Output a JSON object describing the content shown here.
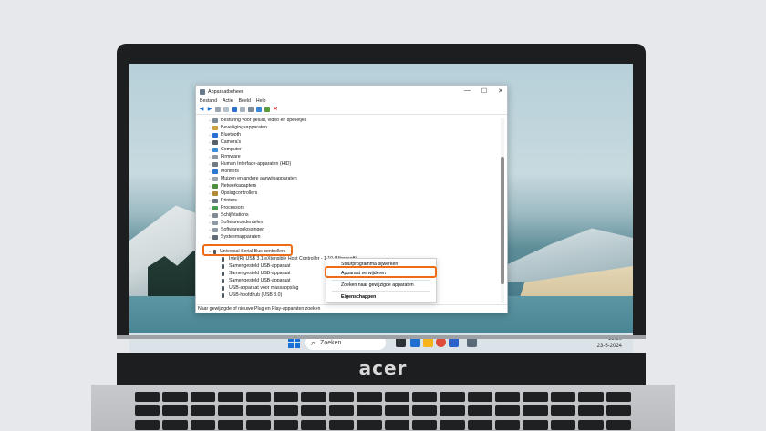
{
  "window": {
    "title": "Apparaatbeheer",
    "controls": {
      "minimize": "—",
      "maximize": "☐",
      "close": "✕"
    }
  },
  "menu": [
    "Bestand",
    "Actie",
    "Beeld",
    "Help"
  ],
  "tree": {
    "categories": [
      "Besturing voor geluid, video en spelletjes",
      "Beveiligingsapparaten",
      "Bluetooth",
      "Camera's",
      "Computer",
      "Firmware",
      "Human Interface-apparaten (HID)",
      "Monitors",
      "Muizen en andere aanwijsapparaten",
      "Netwerkadapters",
      "Opslagcontrollers",
      "Printers",
      "Processors",
      "Schijfstations",
      "Softwareonderdelen",
      "Softwareoplossingen",
      "Systeemapparaten"
    ],
    "expanded": "Universal Serial Bus-controllers",
    "children": [
      "Intel(R) USB 3.1 eXtensible Host Controller - 1.10 (Microsoft)",
      "Samengesteld USB-apparaat",
      "Samengesteld USB-apparaat",
      "Samengesteld USB-apparaat",
      "USB-apparaat voor massaopslag",
      "USB-hoofdhub (USB 3.0)"
    ]
  },
  "context_menu": {
    "items": [
      "Stuurprogramma bijwerken",
      "Apparaat verwijderen",
      "Zoeken naar gewijzigde apparaten",
      "Eigenschappen"
    ]
  },
  "status": "Naar gewijzigde of nieuwe Plug en Play-apparaten zoeken",
  "taskbar": {
    "search_label": "Zoeken",
    "time": "13:20",
    "date": "23-5-2024"
  },
  "laptop": {
    "brand": "acer"
  },
  "colors": {
    "highlight": "#f06b16",
    "accent": "#1a6fd6"
  }
}
